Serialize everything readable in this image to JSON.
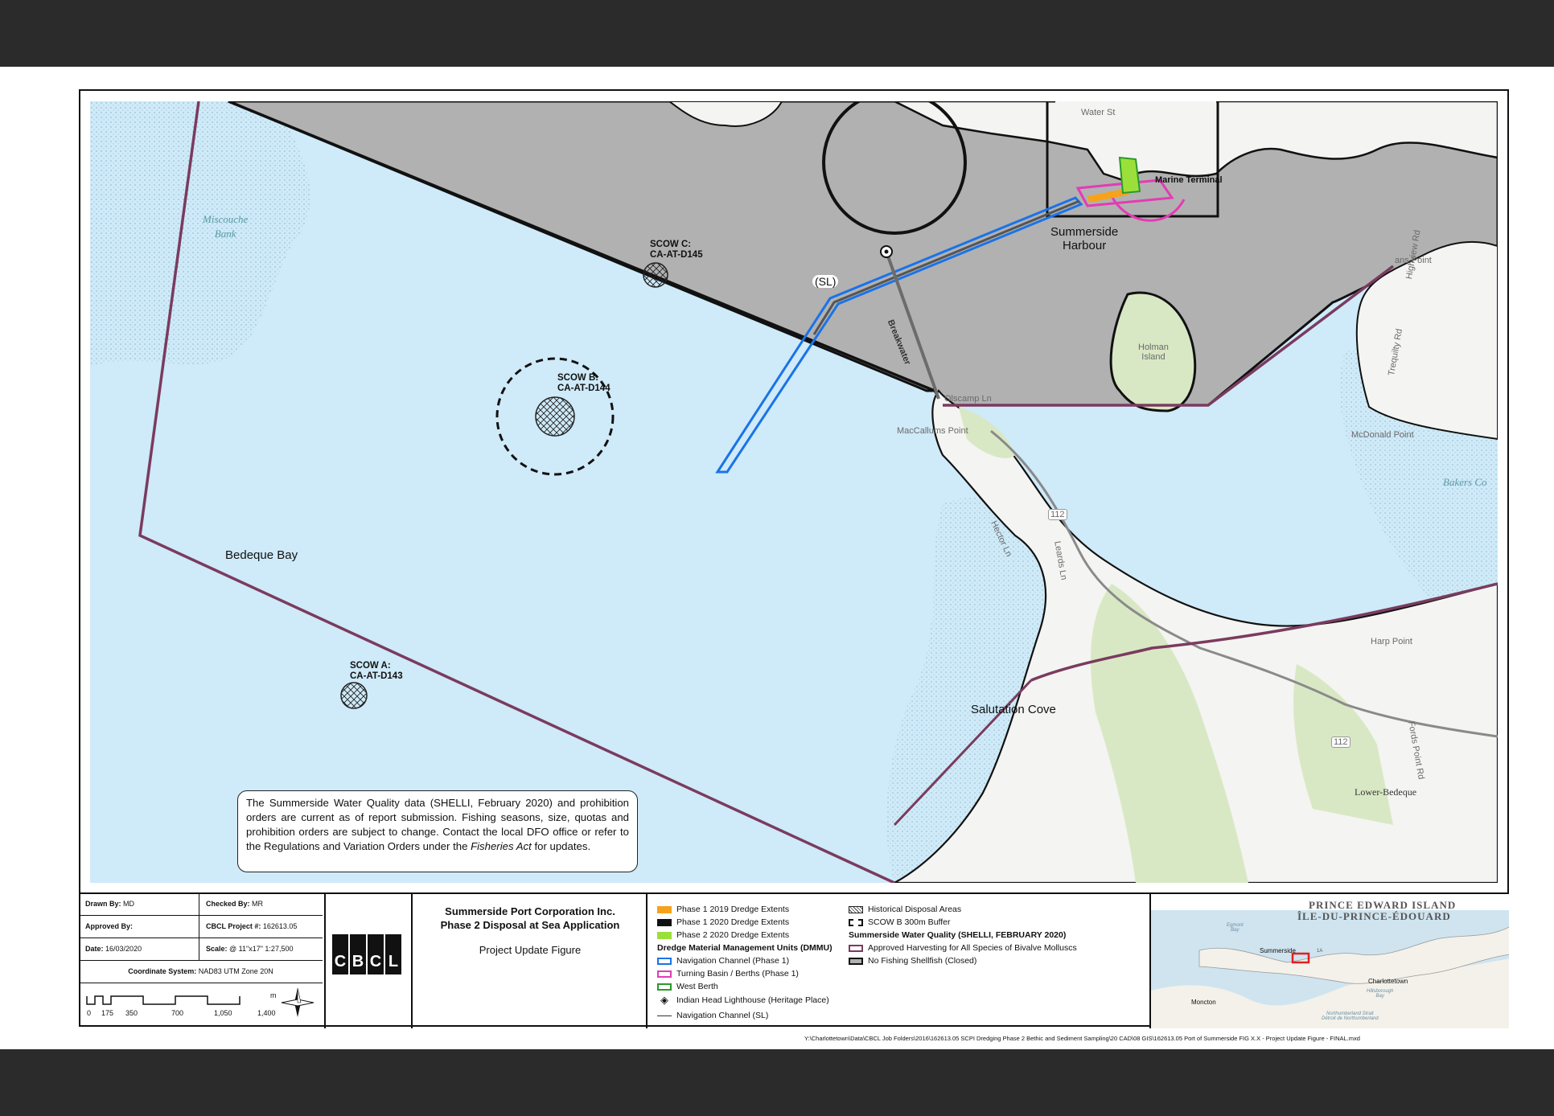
{
  "map": {
    "scows": [
      {
        "name": "SCOW C:",
        "code": "CA-AT-D145"
      },
      {
        "name": "SCOW B:",
        "code": "CA-AT-D144"
      },
      {
        "name": "SCOW A:",
        "code": "CA-AT-D143"
      }
    ],
    "places": {
      "bedeque_bay": "Bedeque Bay",
      "salutation_cove": "Salutation Cove",
      "summerside_harbour_1": "Summerside",
      "summerside_harbour_2": "Harbour",
      "marine_terminal": "Marine Terminal",
      "holman_1": "Holman",
      "holman_2": "Island",
      "sl": "(SL)",
      "breakwater": "Breakwater",
      "maccallums_point": "MacCallums Point",
      "olscamp_ln": "Olscamp Ln",
      "hector_ln": "Hector Ln",
      "leards_ln": "Leards Ln",
      "mcdonald_point": "McDonald Point",
      "lower_bedeque": "Lower-Bedeque",
      "bakers_cove": "Bakers Co",
      "miscouche_1": "Miscouche",
      "miscouche_2": "Bank",
      "route_112a": "112",
      "route_112b": "112",
      "water_st": "Water St",
      "ans_point": "ans Point",
      "highview_rd": "Highview Rd",
      "thompson_rd": "Trequilty Rd",
      "harp_point": "Harp Point",
      "fords_point_rd": "Fords Point Rd"
    },
    "note": {
      "text1": "The Summerside Water Quality data (SHELLI, February 2020) and prohibition orders are current as of report submission. Fishing seasons, size, quotas and prohibition orders are subject to change. Contact the local DFO office or refer to the Regulations and Variation Orders under the ",
      "italic": "Fisheries Act",
      "text2": " for updates."
    },
    "colors": {
      "water": "#cfeaf8",
      "land_grey": "#b1b1b1",
      "land_white": "#f4f4f2",
      "green": "#d9e8c4",
      "harvest_line": "#7a3b5e",
      "nav_channel": "#1a73e8",
      "turning_basin": "#e23cb4",
      "phase1_2019": "#f7a21b",
      "phase2_2020": "#9be03a"
    }
  },
  "title_block": {
    "drawn_by_label": "Drawn By:",
    "drawn_by": "MD",
    "checked_by_label": "Checked By:",
    "checked_by": "MR",
    "approved_by_label": "Approved By:",
    "project_label": "CBCL Project #:",
    "project": "162613.05",
    "date_label": "Date:",
    "date": "16/03/2020",
    "scale_label": "Scale:",
    "scale": "@ 11\"x17\" 1:27,500",
    "coord_label": "Coordinate System:",
    "coord": "NAD83 UTM Zone 20N",
    "scalebar_ticks": [
      "0",
      "175",
      "350",
      "700",
      "1,050",
      "1,400"
    ],
    "scalebar_unit": "m",
    "logo": "CBCL",
    "title1": "Summerside Port Corporation Inc.",
    "title2": "Phase 2 Disposal at Sea Application",
    "subtitle": "Project Update Figure"
  },
  "legend": {
    "left": [
      {
        "label": "Phase 1 2019 Dredge Extents",
        "swatch": "orange"
      },
      {
        "label": "Phase 1 2020 Dredge Extents",
        "swatch": "black"
      },
      {
        "label": "Phase 2 2020 Dredge Extents",
        "swatch": "green"
      },
      {
        "label": "Dredge Material Management Units (DMMU)",
        "swatch": "header"
      },
      {
        "label": "Navigation Channel (Phase 1)",
        "swatch": "blue-outline"
      },
      {
        "label": "Turning Basin / Berths (Phase 1)",
        "swatch": "pink-outline"
      },
      {
        "label": "West Berth",
        "swatch": "green-outline"
      },
      {
        "label": "Indian Head Lighthouse (Heritage Place)",
        "swatch": "lighthouse"
      },
      {
        "label": "Navigation Channel (SL)",
        "swatch": "line"
      }
    ],
    "right": [
      {
        "label": "Historical Disposal Areas",
        "swatch": "hatch"
      },
      {
        "label": "SCOW B 300m Buffer",
        "swatch": "dashed"
      },
      {
        "label": "Summerside Water Quality (SHELLI, FEBRUARY 2020)",
        "swatch": "header"
      },
      {
        "label": "Approved Harvesting for All Species of Bivalve Molluscs",
        "swatch": "purple-outline"
      },
      {
        "label": "No Fishing Shellfish (Closed)",
        "swatch": "black-outline"
      }
    ]
  },
  "inset": {
    "title_en": "PRINCE EDWARD ISLAND",
    "title_fr": "ÎLE-DU-PRINCE-ÉDOUARD",
    "summerside": "Summerside",
    "charlottetown": "Charlottetown",
    "moncton": "Moncton",
    "hillsborough_1": "Hillsborough",
    "hillsborough_2": "Bay",
    "egmont_1": "Egmont",
    "egmont_2": "Bay",
    "strait_1": "Northumberland Strait",
    "strait_2": "Détroit de Northumberland",
    "route": "1A"
  },
  "footer": "Y:\\Charlottetown\\Data\\CBCL Job Folders\\2016\\162613.05 SCPI Dredging Phase 2 Bethic and Sediment Sampling\\20 CAD\\08 GIS\\162613.05 Port of Summerside FIG X.X - Project Update Figure - FINAL.mxd"
}
